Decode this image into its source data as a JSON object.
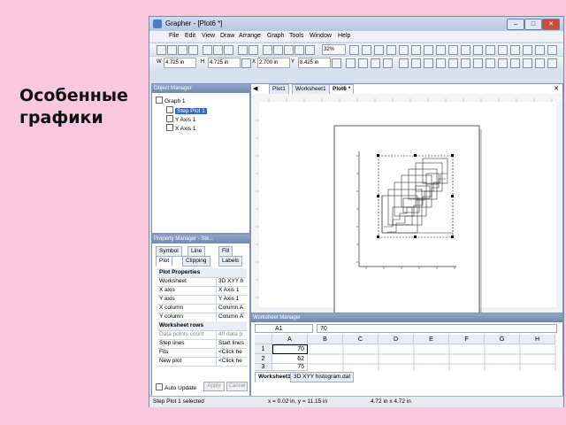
{
  "slide_title": [
    "Особенные",
    "графики"
  ],
  "window": {
    "title": "Grapher - [Plot6 *]",
    "buttons": [
      "–",
      "□",
      "✕"
    ]
  },
  "menu": [
    "File",
    "Edit",
    "View",
    "Draw",
    "Arrange",
    "Graph",
    "Tools",
    "Window",
    "Help"
  ],
  "toolbar": {
    "zoom": "32%",
    "w_label": "W",
    "w_value": "4.725 in",
    "h_label": "H",
    "h_value": "4.725 in",
    "x_label": "X",
    "x_value": "2.700 in",
    "y_label": "Y",
    "y_value": "8.425 in"
  },
  "object_manager": {
    "title": "Object Manager",
    "items": [
      {
        "label": "Graph 1",
        "selected": false
      },
      {
        "label": "Step Plot 1",
        "selected": true
      },
      {
        "label": "Y Axis 1",
        "selected": false
      },
      {
        "label": "X Axis 1",
        "selected": false
      }
    ]
  },
  "property_manager": {
    "title": "Property Manager - Ste...",
    "tabs": [
      "Symbol",
      "Line",
      "Fill",
      "Plot",
      "Clipping",
      "Labels"
    ],
    "rows": [
      {
        "k": "Plot Properties",
        "v": "",
        "type": "section"
      },
      {
        "k": "Worksheet",
        "v": "3D XYY h",
        "type": "row"
      },
      {
        "k": "X axis",
        "v": "X Axis 1",
        "type": "row"
      },
      {
        "k": "Y axis",
        "v": "Y Axis 1",
        "type": "row"
      },
      {
        "k": "X column",
        "v": "Column A",
        "type": "row"
      },
      {
        "k": "Y column",
        "v": "Column A",
        "type": "row"
      },
      {
        "k": "Worksheet rows",
        "v": "",
        "type": "section"
      },
      {
        "k": "Data points count",
        "v": "40 data p",
        "type": "dim"
      },
      {
        "k": "Step lines",
        "v": "Start lines",
        "type": "row"
      },
      {
        "k": "Fits",
        "v": "<Click he",
        "type": "row"
      },
      {
        "k": "New plot",
        "v": "<Click he",
        "type": "row"
      }
    ],
    "auto_update": "Auto Update",
    "apply": "Apply",
    "cancel": "Cancel"
  },
  "doc_tabs": [
    "Plot1",
    "Worksheet1",
    "Plot6 *"
  ],
  "worksheet_manager": {
    "title": "Worksheet Manager",
    "cell_ref": "A1",
    "cell_value": "70",
    "columns": [
      "A",
      "B",
      "C",
      "D",
      "E",
      "F",
      "G",
      "H"
    ],
    "rows": [
      {
        "n": "1",
        "a": "70"
      },
      {
        "n": "2",
        "a": "62"
      },
      {
        "n": "3",
        "a": "75"
      }
    ],
    "tabs": [
      "Worksheet1",
      "3D XYY histogram.dat"
    ]
  },
  "status": {
    "left": "Step Plot 1 selected",
    "mid": "x = 0.02 in, y = 11.15 in",
    "right": "4.72 in x 4.72 in"
  }
}
